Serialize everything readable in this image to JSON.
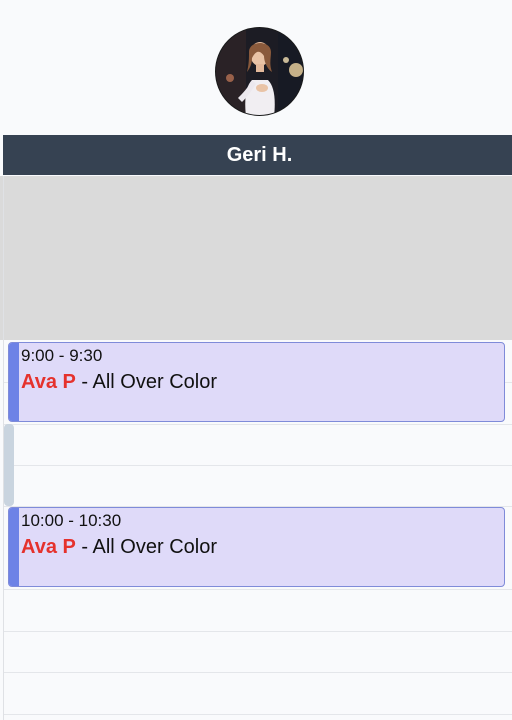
{
  "staff": {
    "name": "Geri H.",
    "avatar_icon": "staff-photo"
  },
  "colors": {
    "header_bg": "#364252",
    "blocked_bg": "#dadada",
    "appointment_bg": "#dfdaf9",
    "appointment_accent": "#6d82e6",
    "client_name": "#e5322d"
  },
  "appointments": [
    {
      "time": "9:00 - 9:30",
      "client": "Ava P",
      "separator": " - ",
      "service": "All Over Color"
    },
    {
      "time": "10:00 - 10:30",
      "client": "Ava P",
      "separator": " - ",
      "service": "All Over Color"
    }
  ]
}
